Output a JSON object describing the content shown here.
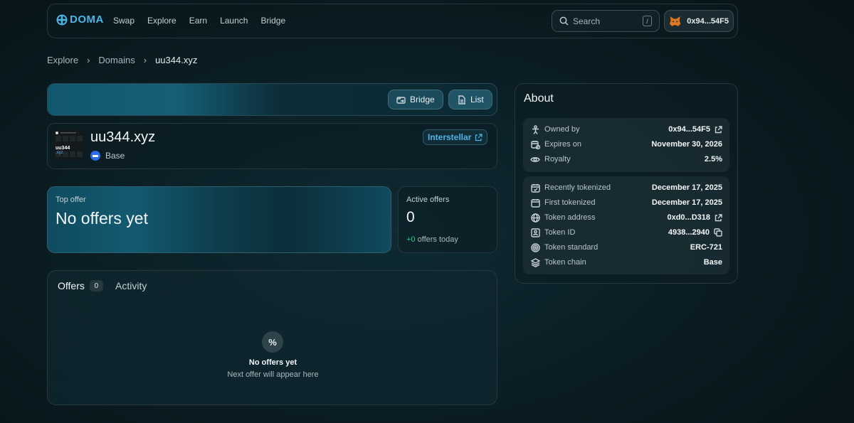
{
  "nav": {
    "logo": "DOMA",
    "links": [
      "Swap",
      "Explore",
      "Earn",
      "Launch",
      "Bridge"
    ],
    "search_placeholder": "Search",
    "search_shortcut": "/",
    "wallet_address": "0x94...54F5"
  },
  "breadcrumb": [
    "Explore",
    "Domains",
    "uu344.xyz"
  ],
  "banner": {
    "bridge_label": "Bridge",
    "list_label": "List"
  },
  "domain": {
    "name": "uu344.xyz",
    "thumb_name": "uu344",
    "thumb_tld": ".xyz",
    "chain": "Base",
    "marketplace": "Interstellar"
  },
  "top_offer": {
    "label": "Top offer",
    "value": "No offers yet"
  },
  "active_offers": {
    "label": "Active offers",
    "value": "0",
    "delta": "+0",
    "delta_suffix": "offers today"
  },
  "offers_panel": {
    "tab_offers": "Offers",
    "offers_count": "0",
    "tab_activity": "Activity",
    "empty_icon": "%",
    "empty_title": "No offers yet",
    "empty_subtitle": "Next offer will appear here"
  },
  "about": {
    "title": "About",
    "group1": [
      {
        "icon": "person-icon",
        "label": "Owned by",
        "value": "0x94...54F5",
        "action": "external-link-icon"
      },
      {
        "icon": "calendar-clock-icon",
        "label": "Expires on",
        "value": "November 30, 2026"
      },
      {
        "icon": "eye-icon",
        "label": "Royalty",
        "value": "2.5%"
      }
    ],
    "group2": [
      {
        "icon": "calendar-check-icon",
        "label": "Recently tokenized",
        "value": "December 17, 2025"
      },
      {
        "icon": "calendar-icon",
        "label": "First tokenized",
        "value": "December 17, 2025"
      },
      {
        "icon": "globe-icon",
        "label": "Token address",
        "value": "0xd0...D318",
        "action": "external-link-icon"
      },
      {
        "icon": "id-card-icon",
        "label": "Token ID",
        "value": "4938...2940",
        "action": "copy-icon"
      },
      {
        "icon": "standard-icon",
        "label": "Token standard",
        "value": "ERC-721"
      },
      {
        "icon": "layers-icon",
        "label": "Token chain",
        "value": "Base"
      }
    ]
  },
  "colors": {
    "accent": "#4fb3e6",
    "positive": "#31c48d",
    "background": "#0a1c22"
  }
}
